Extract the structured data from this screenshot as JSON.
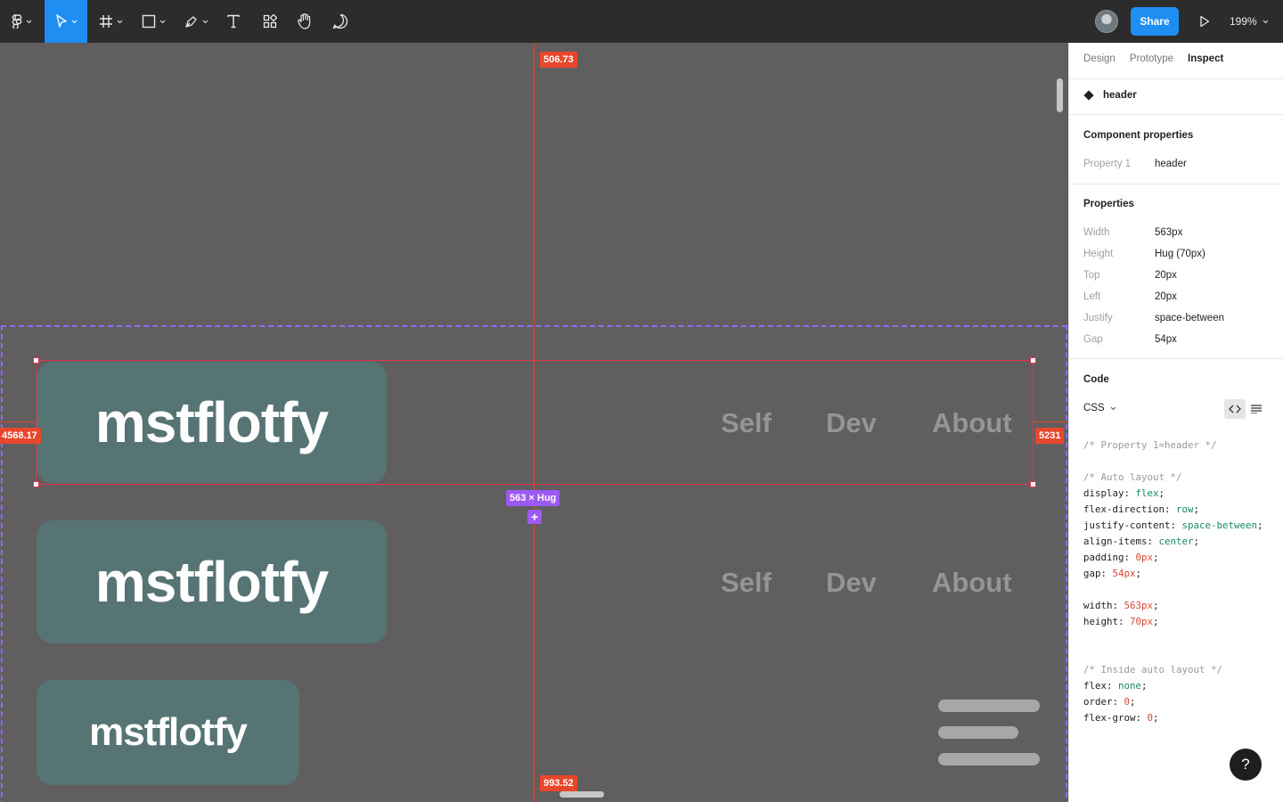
{
  "toolbar": {
    "share_label": "Share",
    "zoom_label": "199%",
    "tools": [
      "main-menu",
      "move",
      "frame",
      "shape",
      "pen",
      "text",
      "resources",
      "hand",
      "comment"
    ]
  },
  "canvas": {
    "measure_top": "506.73",
    "measure_bottom": "993.52",
    "measure_left": "4568.17",
    "measure_right": "5231",
    "size_label": "563 × Hug",
    "headers": [
      {
        "logo": "mstflotfy",
        "nav": [
          "Self",
          "Dev",
          "About"
        ]
      },
      {
        "logo": "mstflotfy",
        "nav": [
          "Self",
          "Dev",
          "About"
        ]
      },
      {
        "logo": "mstflotfy"
      }
    ],
    "accent_colors": {
      "selection": "#e2324d",
      "frame": "#8b6cf2",
      "logo_bg": "#567473"
    }
  },
  "panel": {
    "tabs": [
      "Design",
      "Prototype",
      "Inspect"
    ],
    "active_tab": "Inspect",
    "layer_name": "header",
    "component_title": "Component properties",
    "component_props": [
      {
        "key": "Property 1",
        "value": "header"
      }
    ],
    "properties_title": "Properties",
    "properties": [
      {
        "key": "Width",
        "value": "563px"
      },
      {
        "key": "Height",
        "value": "Hug (70px)"
      },
      {
        "key": "Top",
        "value": "20px"
      },
      {
        "key": "Left",
        "value": "20px"
      },
      {
        "key": "Justify",
        "value": "space-between"
      },
      {
        "key": "Gap",
        "value": "54px"
      }
    ],
    "code_title": "Code",
    "code_lang": "CSS",
    "code_lines": [
      [
        {
          "t": "/* Property 1=header */",
          "c": "comment"
        }
      ],
      [],
      [
        {
          "t": "/* Auto layout */",
          "c": "comment"
        }
      ],
      [
        {
          "t": "display: "
        },
        {
          "t": "flex",
          "c": "green"
        },
        {
          "t": ";"
        }
      ],
      [
        {
          "t": "flex-direction: "
        },
        {
          "t": "row",
          "c": "green"
        },
        {
          "t": ";"
        }
      ],
      [
        {
          "t": "justify-content: "
        },
        {
          "t": "space-between",
          "c": "green"
        },
        {
          "t": ";"
        }
      ],
      [
        {
          "t": "align-items: "
        },
        {
          "t": "center",
          "c": "green"
        },
        {
          "t": ";"
        }
      ],
      [
        {
          "t": "padding: "
        },
        {
          "t": "0px",
          "c": "red"
        },
        {
          "t": ";"
        }
      ],
      [
        {
          "t": "gap: "
        },
        {
          "t": "54px",
          "c": "red"
        },
        {
          "t": ";"
        }
      ],
      [],
      [
        {
          "t": "width: "
        },
        {
          "t": "563px",
          "c": "red"
        },
        {
          "t": ";"
        }
      ],
      [
        {
          "t": "height: "
        },
        {
          "t": "70px",
          "c": "red"
        },
        {
          "t": ";"
        }
      ],
      [],
      [],
      [
        {
          "t": "/* Inside auto layout */",
          "c": "comment"
        }
      ],
      [
        {
          "t": "flex: "
        },
        {
          "t": "none",
          "c": "green"
        },
        {
          "t": ";"
        }
      ],
      [
        {
          "t": "order: "
        },
        {
          "t": "0",
          "c": "red"
        },
        {
          "t": ";"
        }
      ],
      [
        {
          "t": "flex-grow: "
        },
        {
          "t": "0",
          "c": "red"
        },
        {
          "t": ";"
        }
      ]
    ],
    "help_label": "?"
  }
}
